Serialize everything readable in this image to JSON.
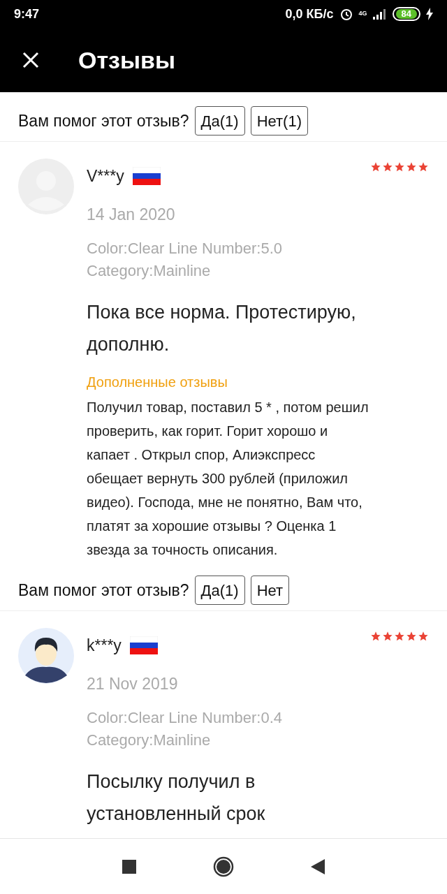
{
  "status_bar": {
    "time": "9:47",
    "network_speed": "0,0 КБ/с",
    "network_type": "4G",
    "battery": "84"
  },
  "header": {
    "title": "Отзывы"
  },
  "reviews": [
    {
      "helpful": {
        "question": "Вам помог этот отзыв?",
        "buttons": [
          "Да(1)",
          "Нет(1)"
        ]
      }
    },
    {
      "avatar": {
        "kind": "placeholder"
      },
      "user": "V***y",
      "stars": 5,
      "date": "14 Jan 2020",
      "details": [
        "Color:Clear Line Number:5.0",
        "Category:Mainline"
      ],
      "text": "Пока все норма. Протестирую, дополню.",
      "additional": {
        "label": "Дополненные отзывы",
        "text": "Получил товар, поставил 5 * , потом решил проверить, как горит. Горит хорошо и капает . Открыл спор, Алиэкспресс обещает вернуть 300 рублей (приложил видео). Господа, мне не понятно, Вам что, платят за хорошие отзывы ? Оценка 1 звезда за точность описания."
      },
      "helpful": {
        "question": "Вам помог этот отзыв?",
        "buttons": [
          "Да(1)",
          "Нет"
        ]
      }
    },
    {
      "avatar": {
        "kind": "person"
      },
      "user": "k***y",
      "stars": 5,
      "date": "21 Nov 2019",
      "details": [
        "Color:Clear Line Number:0.4",
        "Category:Mainline"
      ],
      "text": "Посылку получил в установленный срок"
    }
  ]
}
